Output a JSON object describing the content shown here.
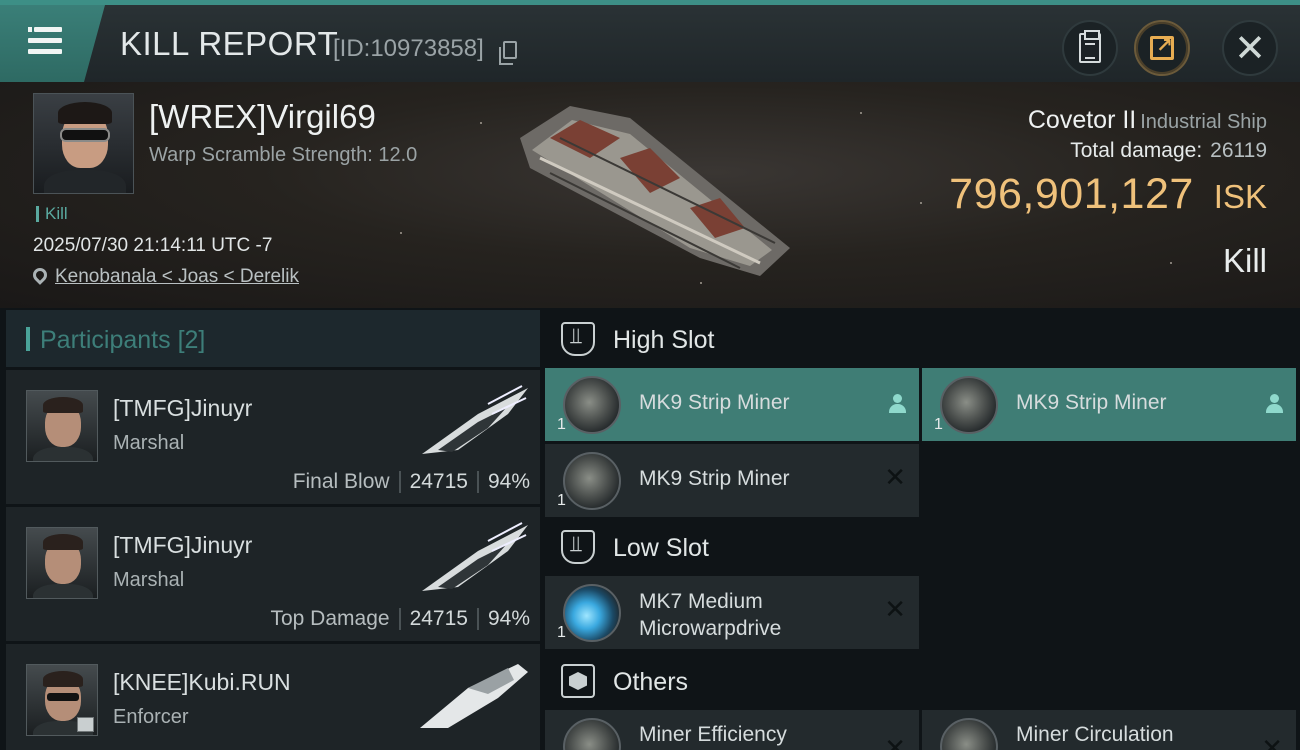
{
  "header": {
    "title": "KILL REPORT",
    "report_id": "[ID:10973858]"
  },
  "victim": {
    "name": "[WREX]Virgil69",
    "subtitle": "Warp Scramble Strength: 12.0",
    "tag": "Kill",
    "timestamp": "2025/07/30 21:14:11 UTC -7",
    "location": "Kenobanala < Joas < Derelik",
    "ship_name": "Covetor II",
    "ship_class": "Industrial Ship",
    "damage_label": "Total damage:",
    "damage_value": "26119",
    "isk_amount": "796,901,127",
    "isk_unit": "ISK",
    "result": "Kill"
  },
  "participants": {
    "title": "Participants",
    "count": "[2]",
    "rows": [
      {
        "name": "[TMFG]Jinuyr",
        "ship": "Marshal",
        "role": "Final Blow",
        "damage": "24715",
        "percent": "94%"
      },
      {
        "name": "[TMFG]Jinuyr",
        "ship": "Marshal",
        "role": "Top Damage",
        "damage": "24715",
        "percent": "94%"
      },
      {
        "name": "[KNEE]Kubi.RUN",
        "ship": "Enforcer"
      }
    ]
  },
  "fitting": {
    "high_slot": {
      "title": "High Slot",
      "items": [
        {
          "name": "MK9 Strip Miner",
          "qty": "1",
          "status": "pilot",
          "highlight": true
        },
        {
          "name": "MK9 Strip Miner",
          "qty": "1",
          "status": "pilot",
          "highlight": true
        },
        {
          "name": "MK9 Strip Miner",
          "qty": "1",
          "status": "destroyed",
          "highlight": false
        }
      ]
    },
    "low_slot": {
      "title": "Low Slot",
      "items": [
        {
          "name_line1": "MK7 Medium",
          "name_line2": "Microwarpdrive",
          "qty": "1",
          "status": "destroyed"
        }
      ]
    },
    "others": {
      "title": "Others",
      "items": [
        {
          "name": "Miner Efficiency",
          "status": "destroyed"
        },
        {
          "name": "Miner Circulation",
          "status": "destroyed"
        }
      ]
    }
  },
  "colors": {
    "accent": "#3f7d75",
    "isk": "#efc17b",
    "header_teal": "#3d8f86"
  },
  "icons": [
    "menu-icon",
    "copy-icon",
    "clipboard-icon",
    "share-icon",
    "close-icon",
    "location-pin-icon",
    "pilot-icon",
    "destroyed-x-icon",
    "high-slot-icon",
    "low-slot-icon",
    "cube-icon"
  ]
}
